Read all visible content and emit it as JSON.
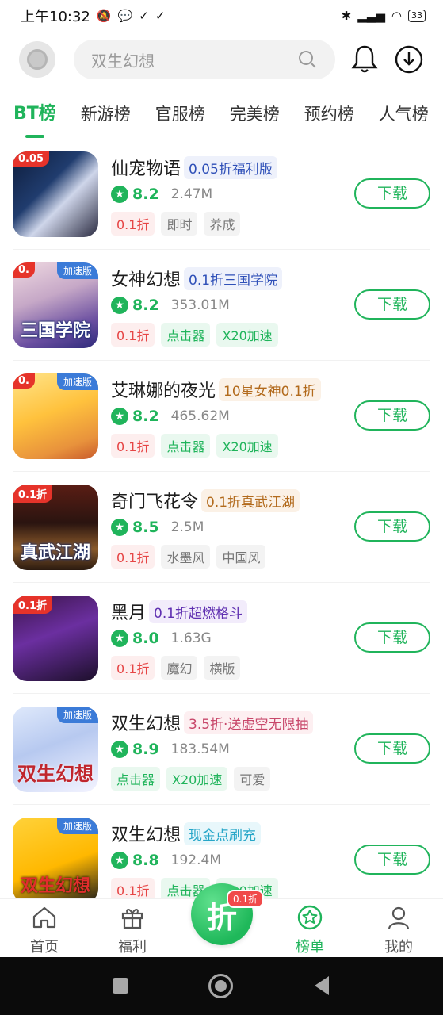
{
  "status_bar": {
    "time": "上午10:32",
    "icons": [
      "mute-icon",
      "chat-bubble-icon",
      "check-icon",
      "check-icon"
    ],
    "battery": "33"
  },
  "search": {
    "placeholder": "双生幻想"
  },
  "tabs": [
    {
      "label": "BT榜",
      "active": true
    },
    {
      "label": "新游榜",
      "active": false
    },
    {
      "label": "官服榜",
      "active": false
    },
    {
      "label": "完美榜",
      "active": false
    },
    {
      "label": "预约榜",
      "active": false
    },
    {
      "label": "人气榜",
      "active": false
    }
  ],
  "games": [
    {
      "name": "仙宠物语",
      "promo": "0.05折福利版",
      "rating": "8.2",
      "size": "2.47M",
      "tags": [
        {
          "text": "0.1折",
          "style": "red"
        },
        {
          "text": "即时",
          "style": "gray"
        },
        {
          "text": "养成",
          "style": "gray"
        }
      ],
      "thumb_badge": "",
      "thumb_discount": "0.05",
      "thumb_caption": "",
      "download": "下载"
    },
    {
      "name": "女神幻想",
      "promo": "0.1折三国学院",
      "rating": "8.2",
      "size": "353.01M",
      "tags": [
        {
          "text": "0.1折",
          "style": "red"
        },
        {
          "text": "点击器",
          "style": "green"
        },
        {
          "text": "X20加速",
          "style": "green"
        }
      ],
      "thumb_badge": "加速版",
      "thumb_discount": "0.",
      "thumb_caption": "三国学院",
      "download": "下载"
    },
    {
      "name": "艾琳娜的夜光",
      "promo": "10星女神0.1折",
      "rating": "8.2",
      "size": "465.62M",
      "tags": [
        {
          "text": "0.1折",
          "style": "red"
        },
        {
          "text": "点击器",
          "style": "green"
        },
        {
          "text": "X20加速",
          "style": "green"
        }
      ],
      "thumb_badge": "加速版",
      "thumb_discount": "0.",
      "thumb_caption": "",
      "download": "下载"
    },
    {
      "name": "奇门飞花令",
      "promo": "0.1折真武江湖",
      "rating": "8.5",
      "size": "2.5M",
      "tags": [
        {
          "text": "0.1折",
          "style": "red"
        },
        {
          "text": "水墨风",
          "style": "gray"
        },
        {
          "text": "中国风",
          "style": "gray"
        }
      ],
      "thumb_badge": "",
      "thumb_discount": "0.1折",
      "thumb_caption": "真武江湖",
      "download": "下载"
    },
    {
      "name": "黑月",
      "promo": "0.1折超燃格斗",
      "rating": "8.0",
      "size": "1.63G",
      "tags": [
        {
          "text": "0.1折",
          "style": "red"
        },
        {
          "text": "魔幻",
          "style": "gray"
        },
        {
          "text": "横版",
          "style": "gray"
        }
      ],
      "thumb_badge": "",
      "thumb_discount": "0.1折",
      "thumb_caption": "",
      "download": "下载"
    },
    {
      "name": "双生幻想",
      "promo": "3.5折·送虚空无限抽",
      "rating": "8.9",
      "size": "183.54M",
      "tags": [
        {
          "text": "点击器",
          "style": "green"
        },
        {
          "text": "X20加速",
          "style": "green"
        },
        {
          "text": "可爱",
          "style": "gray"
        }
      ],
      "thumb_badge": "加速版",
      "thumb_discount": "",
      "thumb_caption": "双生幻想",
      "download": "下载"
    },
    {
      "name": "双生幻想",
      "promo": "现金点刷充",
      "rating": "8.8",
      "size": "192.4M",
      "tags": [
        {
          "text": "0.1折",
          "style": "red"
        },
        {
          "text": "点击器",
          "style": "green"
        },
        {
          "text": "X20加速",
          "style": "green"
        }
      ],
      "thumb_badge": "加速版",
      "thumb_discount": "",
      "thumb_caption": "双生幻想",
      "download": "下载"
    }
  ],
  "promo_colors": [
    "blue",
    "blue",
    "orange",
    "orange",
    "purple",
    "pink",
    "cyan"
  ],
  "bottom_nav": {
    "items": [
      {
        "label": "首页",
        "icon": "home-icon"
      },
      {
        "label": "福利",
        "icon": "gift-icon"
      },
      {
        "label": "榜单",
        "icon": "ranking-star-icon",
        "active": true
      },
      {
        "label": "我的",
        "icon": "user-icon"
      }
    ],
    "center_label": "折",
    "center_badge": "0.1折"
  },
  "colors": {
    "accent": "#20b45b"
  }
}
